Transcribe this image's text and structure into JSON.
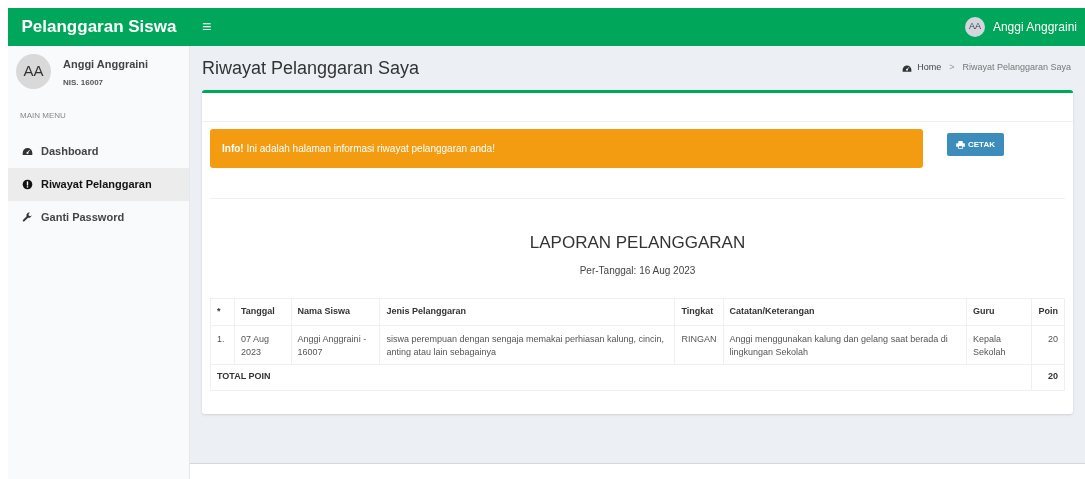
{
  "header": {
    "brand": "Pelanggaran Siswa",
    "menu_toggle": "≡",
    "user": {
      "initials": "AA",
      "name": "Anggi Anggraini"
    }
  },
  "sidebar": {
    "user": {
      "initials": "AA",
      "name": "Anggi Anggraini",
      "nis": "NIS. 16007"
    },
    "section": "MAIN MENU",
    "items": [
      {
        "label": "Dashboard",
        "kind": "dashboard",
        "selected": false
      },
      {
        "label": "Riwayat Pelanggaran",
        "kind": "alert",
        "selected": true
      },
      {
        "label": "Ganti Password",
        "kind": "wrench",
        "selected": false
      }
    ]
  },
  "page": {
    "title": "Riwayat Pelanggaran Saya",
    "breadcrumb": [
      {
        "label": "Home",
        "kind": "dashboard"
      },
      {
        "label": "Riwayat Pelanggaran Saya",
        "kind": "text"
      }
    ],
    "separator": ">"
  },
  "alert": {
    "strong": "Info!",
    "text": "Ini adalah halaman informasi riwayat pelanggaran anda!"
  },
  "print_button": "CETAK",
  "report": {
    "title": "LAPORAN PELANGGARAN",
    "subtitle": "Per-Tanggal: 16 Aug 2023",
    "columns": [
      "*",
      "Tanggal",
      "Nama Siswa",
      "Jenis Pelanggaran",
      "Tingkat",
      "Catatan/Keterangan",
      "Guru",
      "Poin"
    ],
    "rows": [
      [
        "1.",
        "07 Aug 2023",
        "Anggi Anggraini - 16007",
        "siswa perempuan dengan sengaja memakai perhiasan kalung, cincin, anting atau lain sebagainya",
        "RINGAN",
        "Anggi menggunakan kalung dan gelang saat berada di lingkungan Sekolah",
        "Kepala Sekolah",
        "20"
      ]
    ],
    "total_label": "TOTAL POIN",
    "total_value": "20"
  }
}
